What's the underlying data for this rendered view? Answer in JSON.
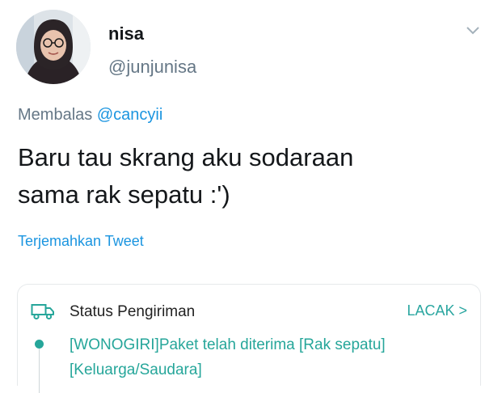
{
  "tweet": {
    "author": {
      "name": "nisa",
      "handle": "@junjunisa",
      "avatar_icon": "user-avatar-photo"
    },
    "reply_prefix": "Membalas",
    "reply_to": "@cancyii",
    "text_line1": "Baru tau skrang aku sodaraan",
    "text_line2": "sama rak sepatu :')",
    "translate_label": "Terjemahkan Tweet",
    "menu_icon": "chevron-down-icon"
  },
  "shipping_card": {
    "icon": "truck-icon",
    "title": "Status Pengiriman",
    "track_label": "LACAK >",
    "status_line1": "[WONOGIRI]Paket telah diterima [Rak sepatu]",
    "status_line2": "[Keluarga/Saudara]",
    "accent_color": "#26a69a"
  },
  "colors": {
    "link_blue": "#1b95e0",
    "muted_gray": "#657786",
    "text_dark": "#14171a"
  }
}
